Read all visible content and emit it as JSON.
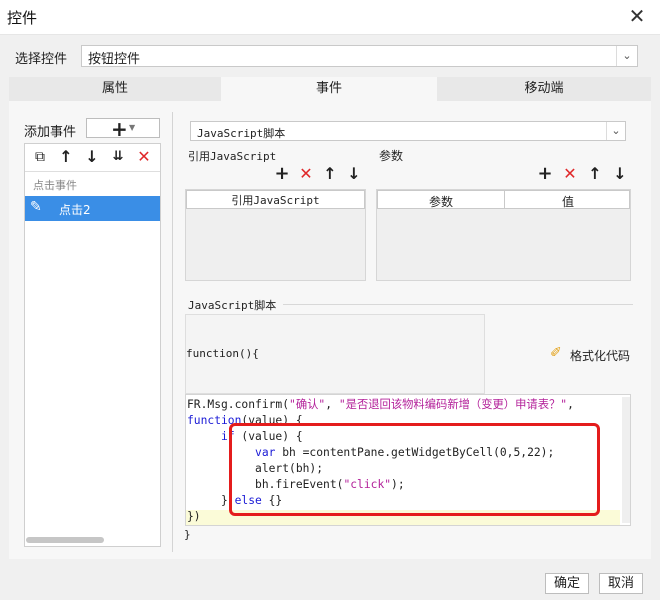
{
  "window": {
    "title": "控件",
    "close_glyph": "✕"
  },
  "widget_select": {
    "label": "选择控件",
    "value": "按钮控件"
  },
  "tabs": [
    {
      "label": "属性"
    },
    {
      "label": "事件"
    },
    {
      "label": "移动端"
    }
  ],
  "events": {
    "add_label": "添加事件",
    "add_glyph": "+",
    "group_label": "点击事件",
    "items": [
      {
        "label": "点击2"
      }
    ]
  },
  "script_type": {
    "value": "JavaScript脚本"
  },
  "ref_js": {
    "label": "引用JavaScript",
    "column": "引用JavaScript"
  },
  "params": {
    "label": "参数",
    "columns": [
      "参数",
      "值"
    ]
  },
  "script": {
    "section_label": "JavaScript脚本",
    "header": "function(){",
    "format_label": "格式化代码",
    "closing": "}"
  },
  "code_lines": [
    [
      [
        "FR.Msg.confirm(",
        "plain"
      ],
      [
        "\"确认\"",
        "str"
      ],
      [
        ", ",
        "plain"
      ],
      [
        "\"是否退回该物料编码新增（变更）申请表？\"",
        "str"
      ],
      [
        ",",
        "plain"
      ]
    ],
    [
      [
        "function",
        "kw"
      ],
      [
        "(value) {",
        "plain"
      ]
    ],
    [
      [
        "     ",
        "plain"
      ],
      [
        "if",
        "kw"
      ],
      [
        " (value) {",
        "plain"
      ]
    ],
    [
      [
        "          ",
        "plain"
      ],
      [
        "var",
        "kw"
      ],
      [
        " bh =contentPane.getWidgetByCell(0,5,22);",
        "plain"
      ]
    ],
    [
      [
        "          alert(bh);",
        "plain"
      ]
    ],
    [
      [
        "          bh.fireEvent(",
        "plain"
      ],
      [
        "\"click\"",
        "str"
      ],
      [
        ");",
        "plain"
      ]
    ],
    [
      [
        "     } ",
        "plain"
      ],
      [
        "else",
        "kw"
      ],
      [
        " {}",
        "plain"
      ]
    ],
    [
      [
        "})",
        "plain"
      ]
    ]
  ],
  "footer": {
    "ok": "确定",
    "cancel": "取消"
  },
  "colors": {
    "accent_blue": "#3a8ee6",
    "delete_red": "#e0282a",
    "highlight_red": "#e41c1c",
    "current_line": "#fbfbd8",
    "keyword": "#1a1ad6",
    "string": "#b3219a"
  },
  "icons": [
    "copy-icon",
    "arrow-up-icon",
    "arrow-down-icon",
    "move-bottom-icon",
    "delete-icon",
    "add-icon",
    "edit-icon",
    "brush-icon",
    "chevron-down-icon"
  ]
}
